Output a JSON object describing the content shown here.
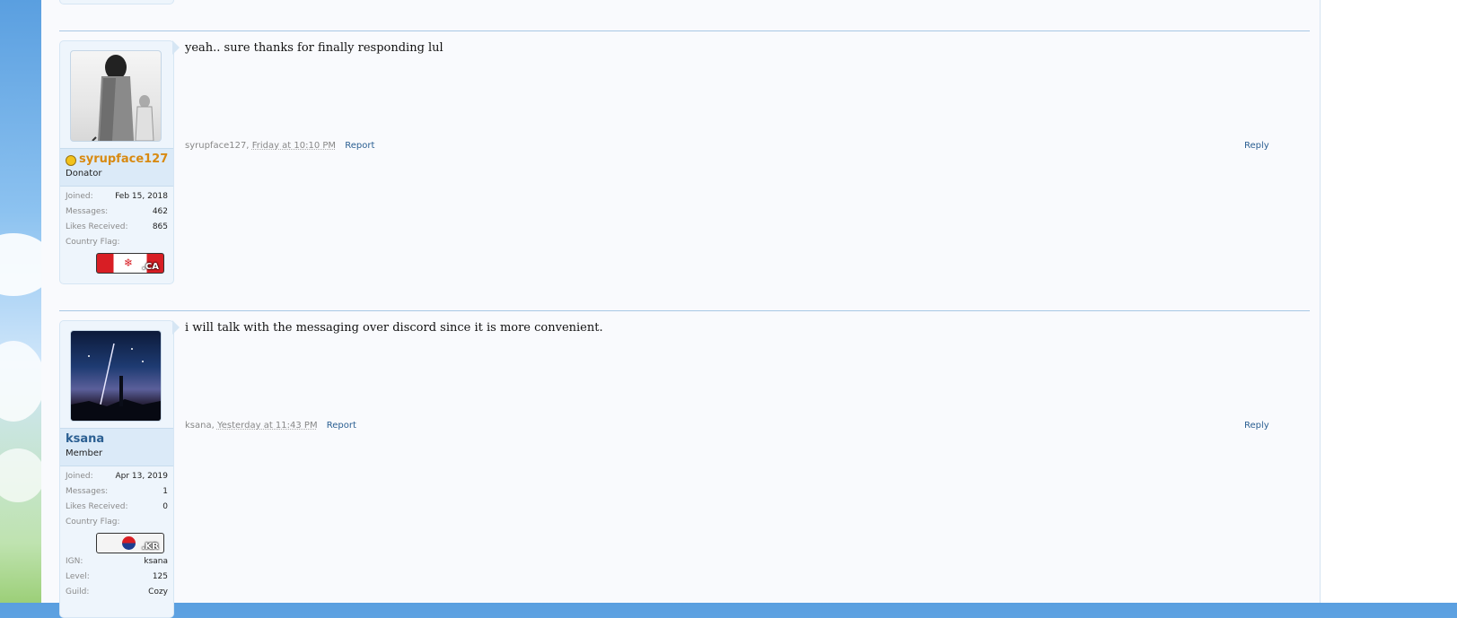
{
  "posts": [
    {
      "username": "syrupface127",
      "user_title": "Donator",
      "username_color": "#d88a12",
      "has_coin_icon": true,
      "extra": [
        {
          "label": "Joined:",
          "value": "Feb 15, 2018"
        },
        {
          "label": "Messages:",
          "value": "462"
        },
        {
          "label": "Likes Received:",
          "value": "865"
        }
      ],
      "flag_label": "Country Flag:",
      "flag_code": ".CA",
      "message": "yeah.. sure thanks for finally responding lul",
      "author": "syrupface127,",
      "date": "Friday at 10:10 PM",
      "report": "Report",
      "reply": "Reply"
    },
    {
      "username": "ksana",
      "user_title": "Member",
      "username_color": "#2b5f92",
      "has_coin_icon": false,
      "extra": [
        {
          "label": "Joined:",
          "value": "Apr 13, 2019"
        },
        {
          "label": "Messages:",
          "value": "1"
        },
        {
          "label": "Likes Received:",
          "value": "0"
        }
      ],
      "flag_label": "Country Flag:",
      "flag_code": ".KR",
      "extra_after": [
        {
          "label": "IGN:",
          "value": "ksana"
        },
        {
          "label": "Level:",
          "value": "125"
        },
        {
          "label": "Guild:",
          "value": "Cozy"
        }
      ],
      "message": "i will talk with the messaging over discord since it is more convenient.",
      "author": "ksana,",
      "date": "Yesterday at 11:43 PM",
      "report": "Report",
      "reply": "Reply"
    }
  ]
}
